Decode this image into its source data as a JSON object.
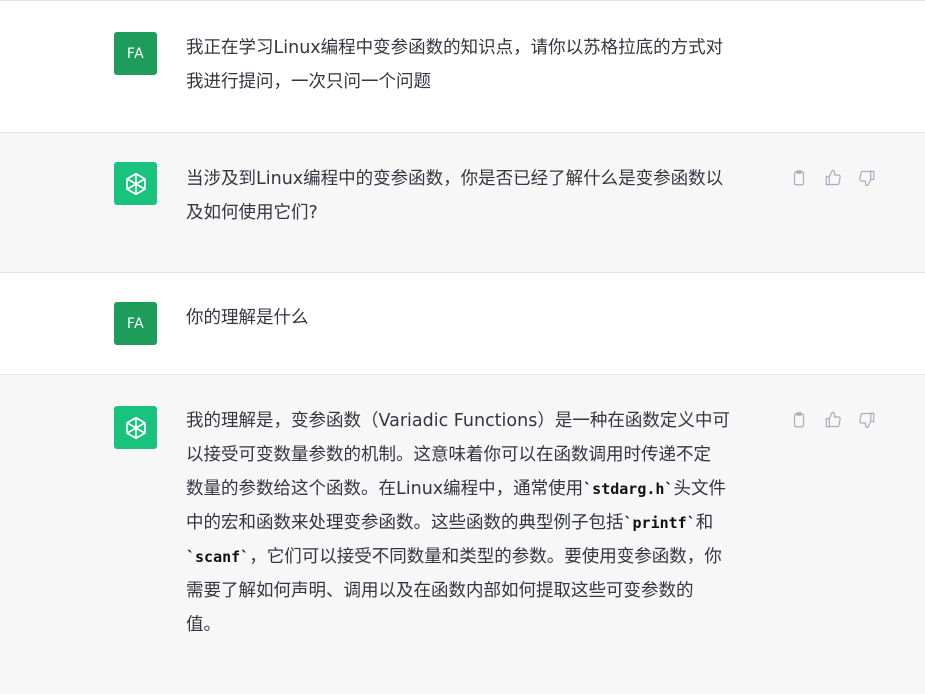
{
  "user_initials": "FA",
  "messages": [
    {
      "role": "user",
      "text": "我正在学习Linux编程中变参函数的知识点，请你以苏格拉底的方式对\n我进行提问，一次只问一个问题"
    },
    {
      "role": "assistant",
      "text": "当涉及到Linux编程中的变参函数，你是否已经了解什么是变参函数以\n及如何使用它们?"
    },
    {
      "role": "user",
      "text": "你的理解是什么"
    },
    {
      "role": "assistant",
      "parts": {
        "p1": "我的理解是，变参函数（Variadic Functions）是一种在函数定义中可\n以接受可变数量参数的机制。这意味着你可以在函数调用时传递不定\n数量的参数给这个函数。在Linux编程中，通常使用",
        "c1": "`stdarg.h`",
        "p2": "头文件\n中的宏和函数来处理变参函数。这些函数的典型例子包括",
        "c2": "`printf`",
        "p3": "和\n",
        "c3": "`scanf`",
        "p4": "，它们可以接受不同数量和类型的参数。要使用变参函数，你\n需要了解如何声明、调用以及在函数内部如何提取这些可变参数的\n值。"
      }
    }
  ],
  "icons": {
    "copy": "clipboard-icon",
    "like": "thumbs-up-icon",
    "dislike": "thumbs-down-icon",
    "bot": "openai-logo-icon"
  },
  "colors": {
    "user_avatar": "#1e9c5a",
    "bot_avatar": "#19c37d",
    "assistant_bg": "#f7f7f8",
    "icon": "#acacbe"
  }
}
